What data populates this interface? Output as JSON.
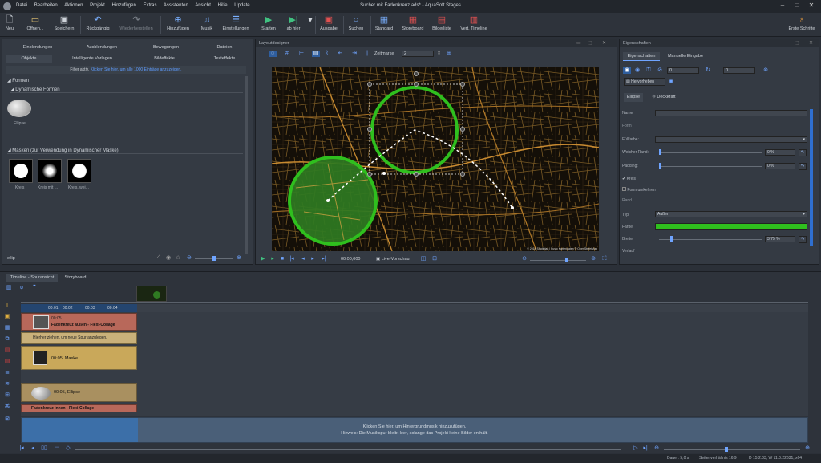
{
  "window": {
    "title": "Sucher mit Fadenkreuz.ads* - AquaSoft Stages"
  },
  "menu": [
    "Datei",
    "Bearbeiten",
    "Aktionen",
    "Projekt",
    "Hinzufügen",
    "Extras",
    "Assistenten",
    "Ansicht",
    "Hilfe",
    "Update"
  ],
  "ribbon": {
    "new": "Neu",
    "open": "Öffnen...",
    "save": "Speichern",
    "undo": "Rückgängig",
    "redo": "Wiederherstellen",
    "add": "Hinzufügen",
    "music": "Musik",
    "settings": "Einstellungen",
    "start": "Starten",
    "from_here": "ab hier",
    "output": "Ausgabe",
    "search": "Suchen",
    "standard": "Standard",
    "storyboard": "Storyboard",
    "picturelist": "Bilderliste",
    "vert_timeline": "Vert. Timeline",
    "first_steps": "Erste Schritte"
  },
  "left": {
    "tabs_row1": [
      "Einblendungen",
      "Ausblendungen",
      "Bewegungen",
      "Dateien"
    ],
    "tabs_row2": [
      "Objekte",
      "Intelligente Vorlagen",
      "Bildeffekte",
      "Texteffekte"
    ],
    "filter_text": "Filter aktiv.",
    "filter_link": "Klicken Sie hier, um alle 1000 Einträge anzuzeigen.",
    "forms": "Formen",
    "dynamic_forms": "Dynamische Formen",
    "ellipse_label": "Ellipse",
    "masks": "Masken (zur Verwendung in Dynamischer Maske)",
    "mask_labels": [
      "Kreis",
      "Kreis mit ...",
      "Kreis, wei..."
    ],
    "search_value": "ellip"
  },
  "center": {
    "title": "Layoutdesigner",
    "zeitmarke_label": "Zeitmarke",
    "zeitmarke_value": "2",
    "time": "00:00,000",
    "live_preview": "Live-Vorschau",
    "map_credit": "© 2014 Stadtplan | Fusio Kartendaten © OpenStreetMap"
  },
  "right": {
    "title": "Eigenschaften",
    "tabs": [
      "Eigenschaften",
      "Manuelle Eingabe"
    ],
    "num1": "0",
    "num2": "0",
    "preset_btn": "Hervorheben",
    "subtabs": [
      "Ellipse",
      "Deckkraft"
    ],
    "name_label": "Name",
    "form_section": "Form",
    "fill_label": "Füllfarbe:",
    "soft_edge_label": "Weicher Rand:",
    "soft_edge_value": "0 %",
    "padding_label": "Padding:",
    "padding_value": "0 %",
    "circle_label": "Kreis",
    "invert_label": "Form umkehren",
    "border_section": "Rand",
    "type_label": "Typ:",
    "type_value": "Außen",
    "color_label": "Farbe:",
    "width_label": "Breite:",
    "width_value": "3,75 %",
    "gradient_label": "Verlauf",
    "accent": "#2fbf1e"
  },
  "timeline": {
    "tabs": [
      "Timeline - Spuransicht",
      "Storyboard"
    ],
    "ruler": [
      "00:01",
      "00:02",
      "00:03",
      "00:04"
    ],
    "tracks": {
      "t1_time": "00:05",
      "t1_title": "Fadenkreuz außen - Flexi-Collage",
      "hint": "Hierher ziehen, um neue Spur anzulegen.",
      "t2_time": "00:05",
      "t2_title": "Maske",
      "t3_time": "00:05",
      "t3_title": "Ellipse",
      "t4_title": "Fadenkreuz innen - Flexi-Collage"
    },
    "music_hint1": "Klicken Sie hier, um Hintergrundmusik hinzuzufügen.",
    "music_hint2": "Hinweis: Die Musikspur bleibt leer, solange das Projekt keine Bilder enthält."
  },
  "status": {
    "duration": "Dauer: 5,0 s",
    "ratio": "Seitenverhältnis 16:9",
    "version": "D 15.2.03, W 11.0.22631, x64"
  }
}
